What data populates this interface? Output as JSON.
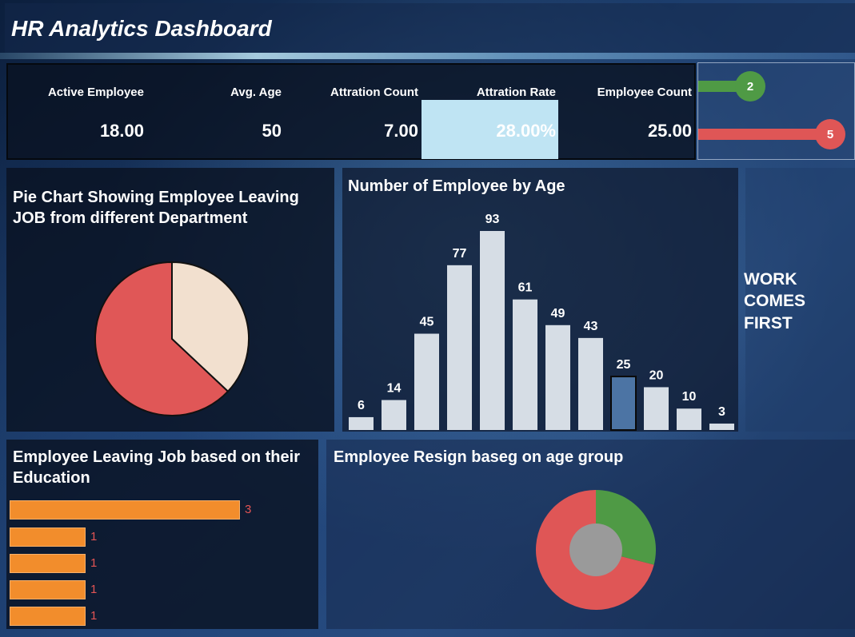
{
  "header": {
    "title": "HR Analytics Dashboard"
  },
  "kpis": [
    {
      "label": "Active Employee",
      "value": "18.00"
    },
    {
      "label": "Avg. Age",
      "value": "50"
    },
    {
      "label": "Attration Count",
      "value": "7.00"
    },
    {
      "label": "Attration Rate",
      "value": "28.00%"
    },
    {
      "label": "Employee Count",
      "value": "25.00"
    }
  ],
  "meter": {
    "green_value": "2",
    "red_value": "5",
    "green_color": "#4f9a45",
    "red_color": "#df5656"
  },
  "pie_chart": {
    "title_line1": "Pie Chart Showing Employee Leaving",
    "title_line2": "JOB from different Department",
    "chart_data": {
      "type": "pie",
      "values": [
        63,
        37
      ],
      "colors": [
        "#e05757",
        "#f2e0cf"
      ]
    }
  },
  "age_chart": {
    "title": "Number of Employee by Age",
    "chart_data": {
      "type": "bar",
      "values": [
        6,
        14,
        45,
        77,
        93,
        61,
        49,
        43,
        25,
        20,
        10,
        3
      ],
      "highlight_index": 8,
      "bar_color": "#d6dde5",
      "highlight_color": "#4c74a4"
    }
  },
  "motto": {
    "line1": "WORK",
    "line2": "COMES",
    "line3": "FIRST"
  },
  "education_chart": {
    "title_line1": "Employee Leaving Job based on their",
    "title_line2": "Education",
    "chart_data": {
      "type": "bar",
      "orientation": "horizontal",
      "values": [
        3,
        1,
        1,
        1,
        1
      ],
      "labels": [
        "3",
        "1",
        "1",
        "1",
        "1"
      ],
      "bar_color": "#f28d2c"
    }
  },
  "resign_chart": {
    "title": "Employee Resign baseg on age group",
    "chart_data": {
      "type": "pie",
      "style": "donut",
      "values": [
        29,
        71
      ],
      "colors": [
        "#4f9a45",
        "#df5656"
      ],
      "center_color": "#9a9a9a"
    }
  }
}
